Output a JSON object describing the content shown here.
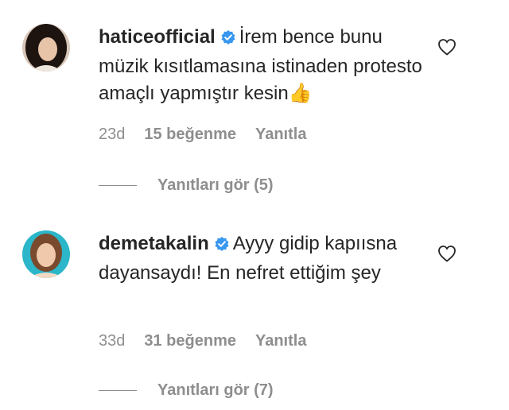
{
  "comments": [
    {
      "username": "haticeofficial",
      "text": "İrem bence bunu müzik kısıtlamasına istinaden protesto amaçlı yapmıştır kesin",
      "emoji": "👍",
      "age": "23d",
      "likes": "15 beğenme",
      "reply_label": "Yanıtla",
      "view_replies": "Yanıtları gör (5)"
    },
    {
      "username": "demetakalin",
      "text": "Ayyy gidip kapıısna dayansaydı! En nefret ettiğim şey",
      "emoji": "",
      "age": "33d",
      "likes": "31 beğenme",
      "reply_label": "Yanıtla",
      "view_replies": "Yanıtları gör (7)"
    }
  ],
  "colors": {
    "text": "#262626",
    "secondary": "#8e8e8e",
    "verified": "#3897f0"
  },
  "icons": [
    "verified-badge-icon",
    "heart-icon"
  ]
}
